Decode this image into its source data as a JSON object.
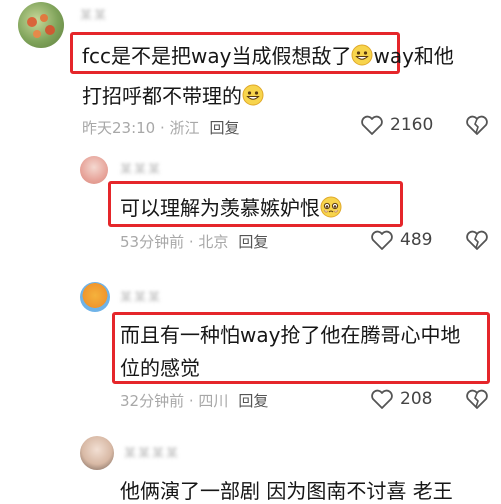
{
  "colors": {
    "highlight": "#e5262a",
    "meta": "#a8a8a8",
    "text": "#161616"
  },
  "comments": [
    {
      "username": "某某",
      "text_line1": "fcc是不是把way当成假想敌了",
      "text_line1_tail": "way和他",
      "text_line2": "打招呼都不带理的",
      "time": "昨天23:10 · 浙江",
      "reply": "回复",
      "likes": "2160",
      "emoji": "grin-emoji"
    },
    {
      "username": "某某某",
      "text": "可以理解为羡慕嫉妒恨",
      "time": "53分钟前 · 北京",
      "reply": "回复",
      "likes": "489",
      "emoji": "pleading-emoji"
    },
    {
      "username": "某某某",
      "text_line1": "而且有一种怕way抢了他在腾哥心中地",
      "text_line2": "位的感觉",
      "time": "32分钟前 · 四川",
      "reply": "回复",
      "likes": "208"
    },
    {
      "username": "某某某某",
      "text": "他俩演了一部剧 因为图南不讨喜 老王"
    }
  ]
}
